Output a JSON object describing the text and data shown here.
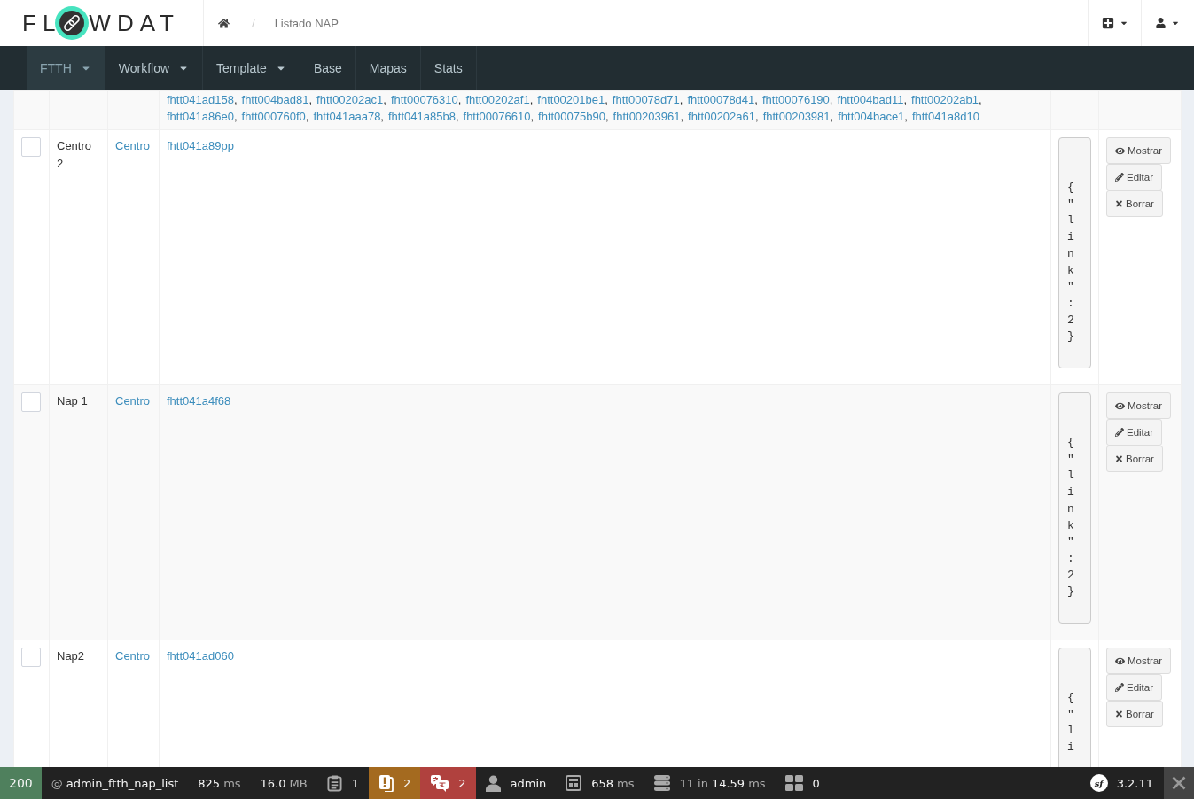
{
  "header": {
    "logo": {
      "text_start": "FL",
      "text_end": "WDAT"
    },
    "breadcrumb": {
      "separator": "/",
      "current": "Listado NAP"
    }
  },
  "nav": {
    "items": [
      {
        "label": "FTTH",
        "selected": true,
        "dropdown": true
      },
      {
        "label": "Workflow",
        "selected": false,
        "dropdown": true
      },
      {
        "label": "Template",
        "selected": false,
        "dropdown": true
      },
      {
        "label": "Base",
        "selected": false,
        "dropdown": false
      },
      {
        "label": "Mapas",
        "selected": false,
        "dropdown": false
      },
      {
        "label": "Stats",
        "selected": false,
        "dropdown": false
      }
    ]
  },
  "table": {
    "rows": [
      {
        "links": [
          {
            "text": "fhtt041ad158",
            "separator": ","
          },
          {
            "text": "fhtt004bad81",
            "separator": ","
          },
          {
            "text": "fhtt00202ac1",
            "separator": ","
          },
          {
            "text": "fhtt00076310",
            "separator": ","
          },
          {
            "text": "fhtt00202af1",
            "separator": ","
          },
          {
            "text": "fhtt00201be1",
            "separator": ","
          },
          {
            "text": "fhtt00078d71",
            "separator": ","
          },
          {
            "text": "fhtt00078d41",
            "separator": ","
          },
          {
            "text": "fhtt00076190",
            "separator": ","
          },
          {
            "text": "fhtt004bad11",
            "separator": ","
          },
          {
            "text": "fhtt00202ab1",
            "separator": ","
          },
          {
            "text": "fhtt041a86e0",
            "separator": ","
          },
          {
            "text": "fhtt000760f0",
            "separator": ","
          },
          {
            "text": "fhtt041aaa78",
            "separator": ","
          },
          {
            "text": "fhtt041a85b8",
            "separator": ","
          },
          {
            "text": "fhtt00076610",
            "separator": ","
          },
          {
            "text": "fhtt00075b90",
            "separator": ","
          },
          {
            "text": "fhtt00203961",
            "separator": ","
          },
          {
            "text": "fhtt00202a61",
            "separator": ","
          },
          {
            "text": "fhtt00203981",
            "separator": ","
          },
          {
            "text": "fhtt004bace1",
            "separator": ","
          },
          {
            "text": "fhtt041a8d10"
          }
        ]
      },
      {
        "checked": false,
        "name": "Centro 2",
        "parent": "Centro",
        "links": [
          {
            "text": "fhtt041a89pp"
          }
        ],
        "json": "{\"link\":2}",
        "actions": [
          {
            "kind": "show",
            "label": "Mostrar"
          },
          {
            "kind": "edit",
            "label": "Editar"
          },
          {
            "kind": "delete",
            "label": "Borrar"
          }
        ]
      },
      {
        "checked": false,
        "name": "Nap 1",
        "parent": "Centro",
        "links": [
          {
            "text": "fhtt041a4f68"
          }
        ],
        "json": "{\"link\":2}",
        "actions": [
          {
            "kind": "show",
            "label": "Mostrar"
          },
          {
            "kind": "edit",
            "label": "Editar"
          },
          {
            "kind": "delete",
            "label": "Borrar"
          }
        ]
      },
      {
        "checked": false,
        "name": "Nap2",
        "parent": "Centro",
        "links": [
          {
            "text": "fhtt041ad060"
          }
        ],
        "json": "{\"li",
        "actions": [
          {
            "kind": "show",
            "label": "Mostrar"
          },
          {
            "kind": "edit",
            "label": "Editar"
          },
          {
            "kind": "delete",
            "label": "Borrar"
          }
        ]
      }
    ]
  },
  "toolbar": {
    "items": [
      {
        "kind": "status",
        "color": "#4f805d",
        "parts": [
          {
            "text": "200",
            "muted": false
          }
        ]
      },
      {
        "kind": "route",
        "parts": [
          {
            "text": "@",
            "muted": true
          },
          {
            "text": "admin_ftth_nap_list",
            "muted": false
          }
        ]
      },
      {
        "kind": "time",
        "parts": [
          {
            "text": "825",
            "muted": false
          },
          {
            "text": "ms",
            "muted": true
          }
        ]
      },
      {
        "kind": "memory",
        "parts": [
          {
            "text": "16.0",
            "muted": false
          },
          {
            "text": "MB",
            "muted": true
          }
        ]
      },
      {
        "kind": "logs",
        "parts": [
          {
            "text": "1",
            "muted": false
          }
        ]
      },
      {
        "kind": "deprecations",
        "color": "#a46a1f",
        "parts": [
          {
            "text": "2",
            "muted": false
          }
        ]
      },
      {
        "kind": "translations",
        "color": "#b0413e",
        "parts": [
          {
            "text": "2",
            "muted": false
          }
        ]
      },
      {
        "kind": "user",
        "parts": [
          {
            "text": "admin",
            "muted": false
          }
        ]
      },
      {
        "kind": "render",
        "parts": [
          {
            "text": "658",
            "muted": false
          },
          {
            "text": "ms",
            "muted": true
          }
        ]
      },
      {
        "kind": "database",
        "parts": [
          {
            "text": "11",
            "muted": false
          },
          {
            "text": "in",
            "muted": true
          },
          {
            "text": "14.59",
            "muted": false
          },
          {
            "text": "ms",
            "muted": true
          }
        ]
      },
      {
        "kind": "layout",
        "parts": [
          {
            "text": "0",
            "muted": false
          }
        ]
      }
    ],
    "version": {
      "logo_text": "sf",
      "number": "3.2.11"
    }
  }
}
